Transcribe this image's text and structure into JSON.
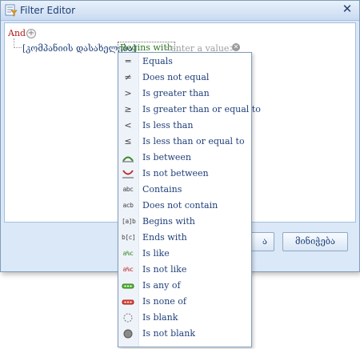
{
  "window": {
    "title": "Filter Editor",
    "close_icon": "close-icon"
  },
  "filter": {
    "group_operator": "And",
    "field": "[კომპანიის დასახელება]",
    "operator": "Begins with",
    "value_placeholder": "<enter a value>"
  },
  "buttons": {
    "ok_label": "ა",
    "cancel_label": "მინიჭება"
  },
  "menu": {
    "items": [
      {
        "label": "Equals",
        "icon": "equals-icon"
      },
      {
        "label": "Does not equal",
        "icon": "not-equal-icon"
      },
      {
        "label": "Is greater than",
        "icon": "greater-than-icon"
      },
      {
        "label": "Is greater than or equal to",
        "icon": "greater-or-equal-icon"
      },
      {
        "label": "Is less than",
        "icon": "less-than-icon"
      },
      {
        "label": "Is less than or equal to",
        "icon": "less-or-equal-icon"
      },
      {
        "label": "Is between",
        "icon": "between-icon"
      },
      {
        "label": "Is not between",
        "icon": "not-between-icon"
      },
      {
        "label": "Contains",
        "icon": "contains-icon"
      },
      {
        "label": "Does not contain",
        "icon": "does-not-contain-icon"
      },
      {
        "label": "Begins with",
        "icon": "begins-with-icon"
      },
      {
        "label": "Ends with",
        "icon": "ends-with-icon"
      },
      {
        "label": "Is like",
        "icon": "is-like-icon"
      },
      {
        "label": "Is not like",
        "icon": "is-not-like-icon"
      },
      {
        "label": "Is any of",
        "icon": "any-of-icon"
      },
      {
        "label": "Is none of",
        "icon": "none-of-icon"
      },
      {
        "label": "Is blank",
        "icon": "blank-icon"
      },
      {
        "label": "Is not blank",
        "icon": "not-blank-icon"
      }
    ]
  },
  "colors": {
    "group_operator": "#b01a1a",
    "operator": "#2d7a1e",
    "placeholder": "#a0a0a0",
    "text": "#1f3f7a"
  }
}
